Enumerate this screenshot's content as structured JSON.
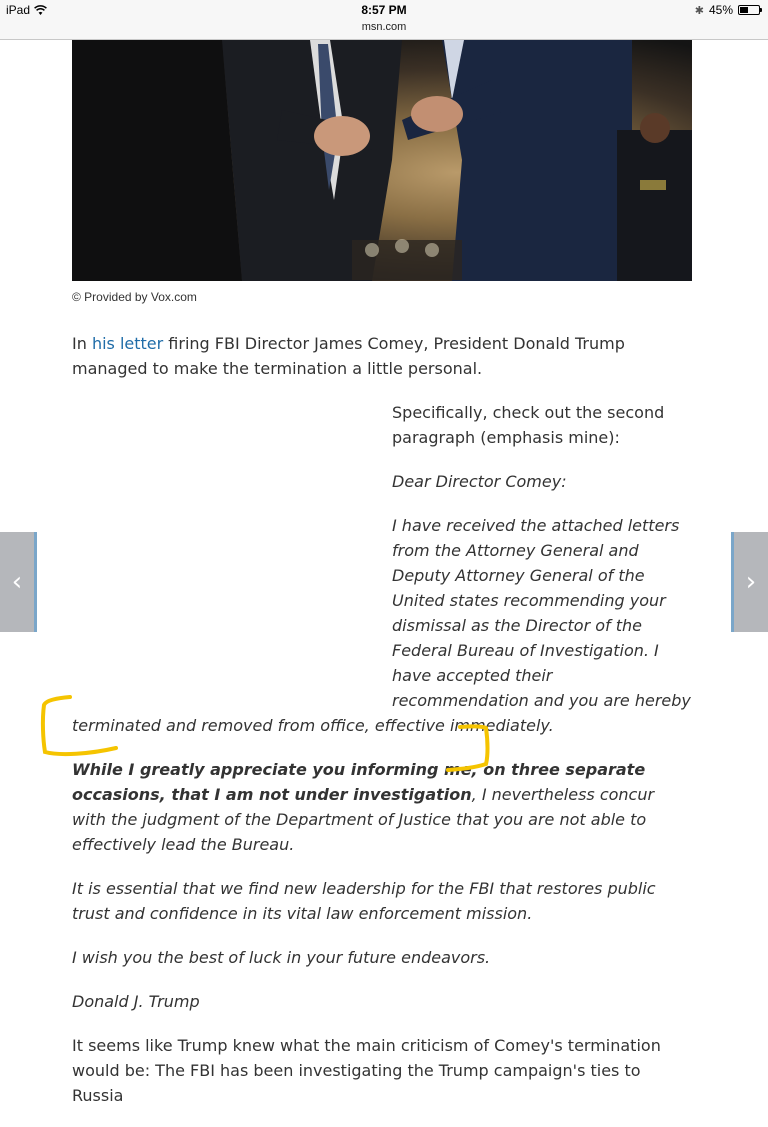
{
  "status_bar": {
    "device": "iPad",
    "time": "8:57 PM",
    "url": "msn.com",
    "battery_text": "45%",
    "battery_level": 0.45
  },
  "photo": {
    "credit": "© Provided by Vox.com"
  },
  "article": {
    "intro_prefix": "In ",
    "intro_link": "his letter",
    "intro_rest": " firing FBI Director James Comey, President Donald Trump managed to make the termination a little personal.",
    "specifically": "Specifically, check out the second paragraph (emphasis mine):",
    "salutation": "Dear Director Comey:",
    "letter_p1": "I have received the attached letters from the Attorney General and Deputy Attorney General of the United states recommending your dismissal as the Director of the Federal Bureau of Investigation. I have accepted their recommendation and you are hereby terminated and removed from office, effective immediately.",
    "letter_p2_bold": "While I greatly appreciate you informing me, on three separate occasions, that I am not under investigation",
    "letter_p2_rest": ", I nevertheless concur with the judgment of the Department of Justice that you are not able to effectively lead the Bureau.",
    "letter_p3": "It is essential that we find new leadership for the FBI that restores public trust and confidence in its vital law enforcement mission.",
    "letter_p4": "I wish you the best of luck in your future endeavors.",
    "signature": "Donald J. Trump",
    "closing": "It seems like Trump knew what the main criticism of Comey's termination would be: The FBI has been investigating the Trump campaign's ties to Russia"
  },
  "nav": {
    "prev_icon": "chevron-left-icon",
    "next_icon": "chevron-right-icon"
  },
  "colors": {
    "link": "#1f6ca8",
    "highlight_marker": "#f5c400",
    "nav_bg": "#b5b7bb"
  }
}
